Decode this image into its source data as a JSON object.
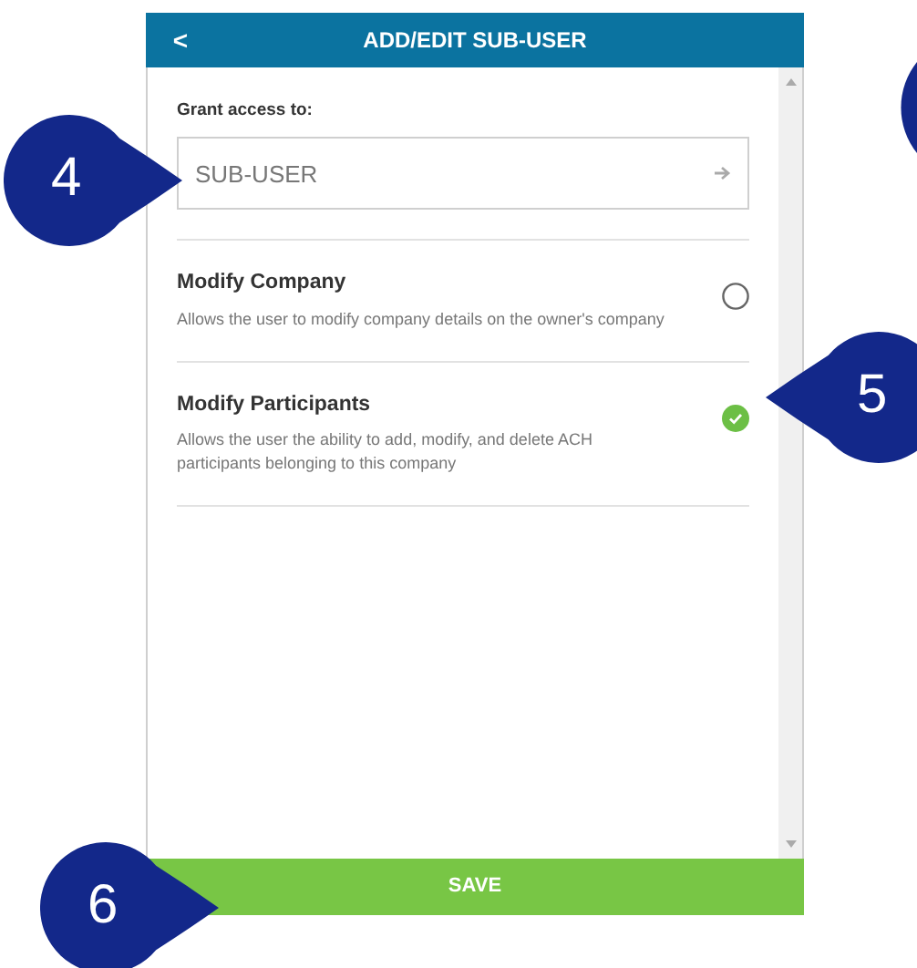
{
  "header": {
    "back": "<",
    "title": "ADD/EDIT SUB-USER"
  },
  "grant": {
    "label": "Grant access to:",
    "value": "SUB-USER"
  },
  "permissions": [
    {
      "title": "Modify Company",
      "description": "Allows the user to modify company details on the owner's company",
      "checked": false
    },
    {
      "title": "Modify Participants",
      "description": "Allows the user the ability to add, modify, and delete ACH participants belonging to this company",
      "checked": true
    }
  ],
  "save_button": "SAVE",
  "callouts": [
    {
      "label": "4"
    },
    {
      "label": "5"
    },
    {
      "label": "6"
    }
  ]
}
